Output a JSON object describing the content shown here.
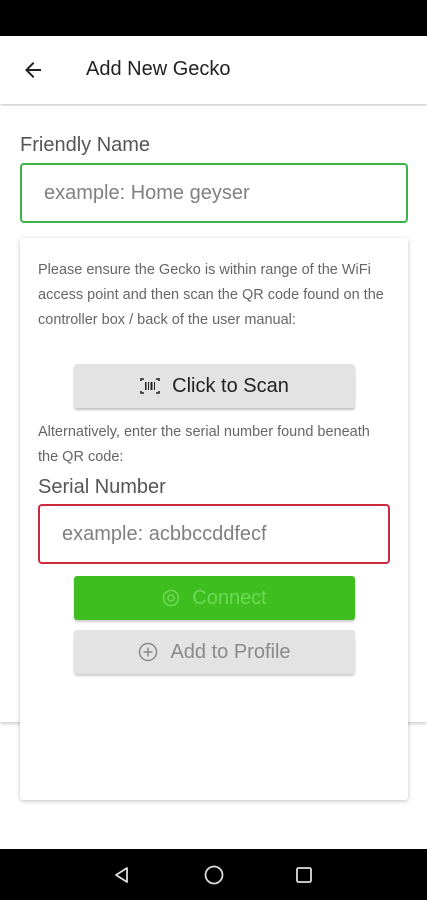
{
  "app_bar": {
    "title": "Add New Gecko",
    "back_icon": "arrow-left-icon"
  },
  "form": {
    "friendly_name_label": "Friendly Name",
    "friendly_name_placeholder": "example: Home geyser",
    "friendly_name_value": ""
  },
  "card": {
    "instructions": "Please ensure the Gecko is within range of the WiFi access point and then scan the QR code found on the controller box / back of the user manual:",
    "scan_button_label": "Click to Scan",
    "scan_icon": "barcode-scan-icon",
    "alternative_text": "Alternatively, enter the serial number found beneath the QR code:",
    "serial_label": "Serial Number",
    "serial_placeholder": "example: acbbccddfecf",
    "serial_value": "",
    "connect_button_label": "Connect",
    "connect_icon": "connect-icon",
    "add_profile_button_label": "Add to Profile",
    "add_profile_icon": "add-circle-icon"
  },
  "colors": {
    "friendly_border": "#3cb34a",
    "serial_border_error": "#cc2a3e",
    "connect_button": "#3fbf1f"
  },
  "nav_bar": {
    "back_icon": "nav-back-triangle-icon",
    "home_icon": "nav-home-circle-icon",
    "recents_icon": "nav-recents-square-icon"
  }
}
